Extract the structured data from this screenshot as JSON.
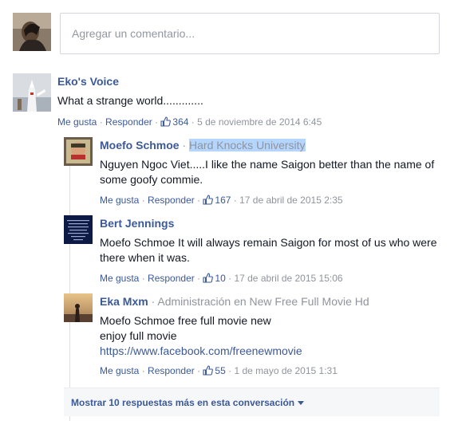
{
  "composer": {
    "placeholder": "Agregar un comentario..."
  },
  "comments": [
    {
      "author": "Eko's Voice",
      "affiliation": "",
      "text": "What a strange world.............",
      "like": "Me gusta",
      "reply": "Responder",
      "likes": "364",
      "time": "5 de noviembre de 2014 6:45"
    }
  ],
  "replies": [
    {
      "author": "Moefo Schmoe",
      "affiliation": "Hard Knocks University",
      "text": "Nguyen Ngoc Viet.....I like the name Saigon better than the name of some goofy commie.",
      "like": "Me gusta",
      "reply": "Responder",
      "likes": "167",
      "time": "17 de abril de 2015 2:35"
    },
    {
      "author": "Bert Jennings",
      "affiliation": "",
      "text": "Moefo Schmoe It will always remain Saigon for most of us who were there when it was.",
      "like": "Me gusta",
      "reply": "Responder",
      "likes": "10",
      "time": "17 de abril de 2015 15:06"
    },
    {
      "author": "Eka Mxm",
      "affiliation": "Administración en New Free Full Movie Hd",
      "text_line1": "Moefo Schmoe free full movie new",
      "text_line2": "enjoy full movie",
      "link": "https://www.facebook.com/freenewmovie",
      "like": "Me gusta",
      "reply": "Responder",
      "likes": "55",
      "time": "1 de mayo de 2015 1:31"
    }
  ],
  "more_replies": {
    "label": "Mostrar 10 respuestas más en esta conversación"
  },
  "separator": " · ",
  "colors": {
    "link": "#3b5998",
    "meta": "#90949c",
    "highlight": "#b4d5fe"
  }
}
